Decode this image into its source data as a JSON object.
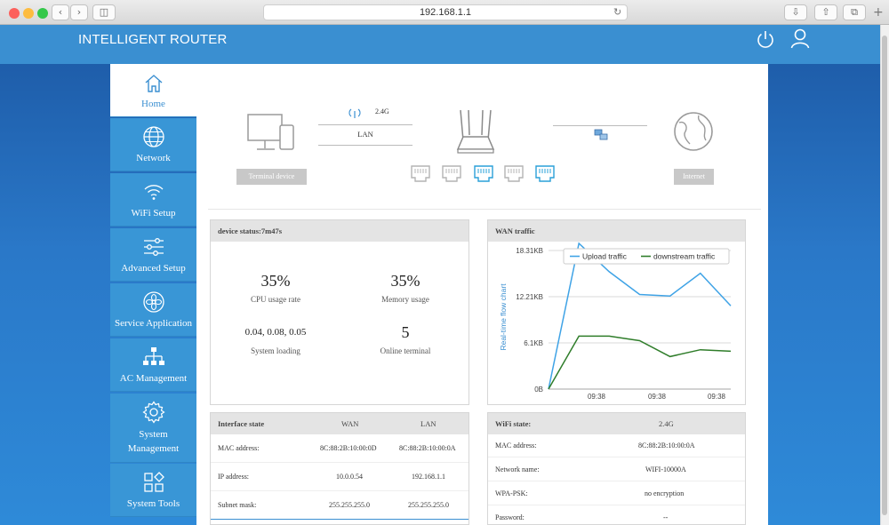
{
  "browser": {
    "url": "192.168.1.1"
  },
  "header": {
    "brand": "INTELLIGENT ROUTER"
  },
  "sidebar": {
    "items": [
      {
        "label": "Home"
      },
      {
        "label": "Network"
      },
      {
        "label": "WiFi Setup"
      },
      {
        "label": "Advanced Setup"
      },
      {
        "label": "Service Application"
      },
      {
        "label": "AC Management"
      },
      {
        "label": "System Management"
      },
      {
        "label": "System Tools"
      }
    ]
  },
  "topology": {
    "band": "2.4G",
    "lan": "LAN",
    "terminal_label": "Terminal device",
    "internet_label": "Internet"
  },
  "device_status": {
    "title": "device status:7m47s",
    "cpu_value": "35%",
    "cpu_label": "CPU usage rate",
    "mem_value": "35%",
    "mem_label": "Memory usage",
    "load_value": "0.04, 0.08, 0.05",
    "load_label": "System loading",
    "online_value": "5",
    "online_label": "Online terminal"
  },
  "wan_traffic": {
    "title": "WAN traffic"
  },
  "chart_data": {
    "type": "line",
    "ylabel": "Real-time flow chart",
    "yticks": [
      "18.31KB",
      "12.21KB",
      "6.1KB",
      "0B"
    ],
    "ylim": [
      0,
      18.31
    ],
    "xticks": [
      "09:38",
      "09:38",
      "09:38"
    ],
    "legend": "top-right",
    "colors": {
      "upload": "#3fa3e6",
      "down": "#2f7d2a"
    },
    "series": [
      {
        "name": "Upload traffic",
        "values": [
          0,
          19.5,
          15.5,
          12.5,
          12.3,
          15.3,
          11.0
        ]
      },
      {
        "name": "downstream traffic",
        "values": [
          0,
          7.0,
          7.0,
          6.4,
          4.3,
          5.2,
          5.0
        ]
      }
    ]
  },
  "interface": {
    "headers": [
      "Interface state",
      "WAN",
      "LAN"
    ],
    "rows": [
      [
        "MAC address:",
        "8C:88:2B:10:00:0D",
        "8C:88:2B:10:00:0A"
      ],
      [
        "IP address:",
        "10.0.0.54",
        "192.168.1.1"
      ],
      [
        "Subnet mask:",
        "255.255.255.0",
        "255.255.255.0"
      ]
    ]
  },
  "wifi": {
    "headers": [
      "WiFi state:",
      "2.4G"
    ],
    "rows": [
      [
        "MAC address:",
        "8C:88:2B:10:00:0A"
      ],
      [
        "Network name:",
        "WIFI-10000A"
      ],
      [
        "WPA-PSK:",
        "no encryption"
      ],
      [
        "Password:",
        "--"
      ]
    ]
  }
}
